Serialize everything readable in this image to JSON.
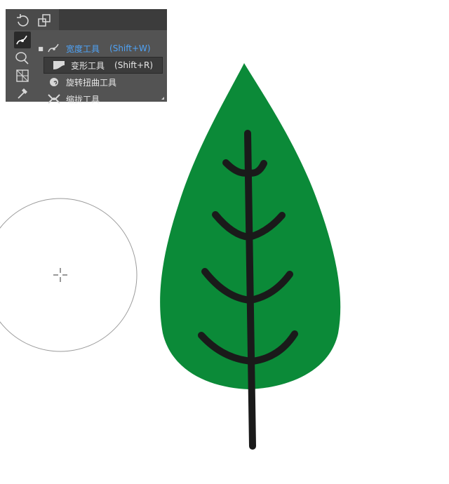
{
  "toolbar": {
    "flyout": {
      "items": [
        {
          "label": "宽度工具",
          "shortcut": "(Shift+W)",
          "icon": "width-tool-icon",
          "active": true
        },
        {
          "label": "变形工具",
          "shortcut": "(Shift+R)",
          "icon": "warp-tool-icon",
          "active": false
        },
        {
          "label": "旋转扭曲工具",
          "shortcut": "",
          "icon": "twirl-tool-icon",
          "active": false
        },
        {
          "label": "缩拢工具",
          "shortcut": "",
          "icon": "pucker-tool-icon",
          "active": false
        }
      ]
    }
  },
  "colors": {
    "leaf_fill": "#0b8a38",
    "vein_stroke": "#1a1a1a",
    "active_text": "#4fa3f7",
    "panel_bg": "#535353"
  }
}
